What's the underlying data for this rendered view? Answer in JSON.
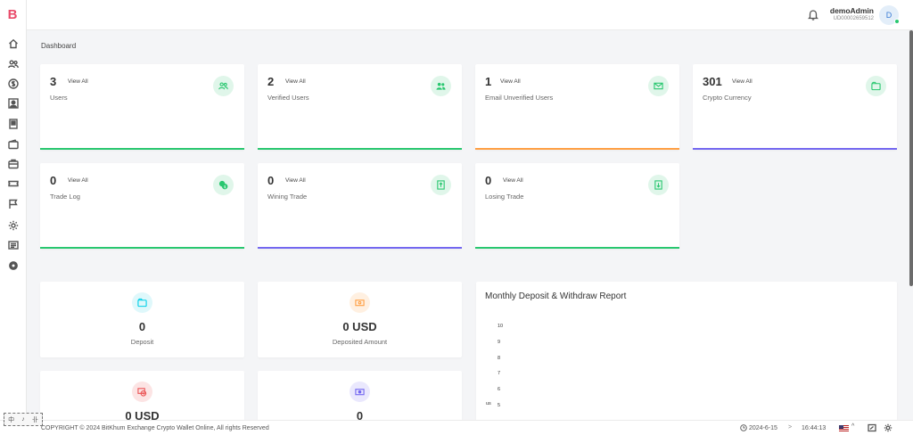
{
  "logo": {
    "letter": "B",
    "color": "#e94b6a"
  },
  "sidebar": {
    "items": [
      {
        "icon": "home-icon"
      },
      {
        "icon": "users-icon"
      },
      {
        "icon": "dollar-icon"
      },
      {
        "icon": "user-card-icon"
      },
      {
        "icon": "document-icon"
      },
      {
        "icon": "wallet-icon"
      },
      {
        "icon": "briefcase-icon"
      },
      {
        "icon": "ticket-icon"
      },
      {
        "icon": "flag-icon"
      },
      {
        "icon": "gear-icon"
      },
      {
        "icon": "list-icon"
      },
      {
        "icon": "settings-icon"
      }
    ]
  },
  "header": {
    "user_name": "demoAdmin",
    "user_id": "UD00002659512",
    "avatar_letter": "D"
  },
  "page_title": "Dashboard",
  "stats": [
    {
      "value": "3",
      "view_label": "View All",
      "label": "Users",
      "icon": "users-icon",
      "accent": "#28c76f"
    },
    {
      "value": "2",
      "view_label": "View All",
      "label": "Verified Users",
      "icon": "verified-users-icon",
      "accent": "#28c76f"
    },
    {
      "value": "1",
      "view_label": "View All",
      "label": "Email Unverified Users",
      "icon": "email-icon",
      "accent": "#ff9f43"
    },
    {
      "value": "301",
      "view_label": "View All",
      "label": "Crypto Currency",
      "icon": "wallet-icon",
      "accent": "#7367f0"
    },
    {
      "value": "0",
      "view_label": "View All",
      "label": "Trade Log",
      "icon": "coins-icon",
      "accent": "#28c76f"
    },
    {
      "value": "0",
      "view_label": "View All",
      "label": "Wining Trade",
      "icon": "upload-icon",
      "accent": "#7367f0"
    },
    {
      "value": "0",
      "view_label": "View All",
      "label": "Losing Trade",
      "icon": "download-icon",
      "accent": "#28c76f"
    }
  ],
  "mini_cards": [
    {
      "value": "0",
      "label": "Deposit",
      "icon": "wallet-icon",
      "color": "#00cfe8"
    },
    {
      "value": "0 USD",
      "label": "Deposited Amount",
      "icon": "cash-icon",
      "color": "#ff9f43"
    },
    {
      "value": "0 USD",
      "label": "",
      "icon": "cash-cancel-icon",
      "color": "#ea5455"
    },
    {
      "value": "0",
      "label": "",
      "icon": "cash-purple-icon",
      "color": "#7367f0"
    }
  ],
  "chart": {
    "title": "Monthly Deposit & Withdraw Report",
    "y_ticks": [
      "10",
      "9",
      "8",
      "7",
      "6",
      "5"
    ],
    "y_label": "us"
  },
  "chart_data": {
    "type": "bar",
    "title": "Monthly Deposit & Withdraw Report",
    "categories": [],
    "series": [],
    "ylim": [
      0,
      10
    ],
    "xlabel": "",
    "ylabel": ""
  },
  "footer": {
    "copyright": "COPYRIGHT © 2024 BitKhum Exchange Crypto Wallet Online, All rights Reserved",
    "date": "2024-6-15",
    "separator": ">",
    "time": "16:44:13",
    "caret": "^"
  },
  "tools": {
    "a": "中",
    "b": "♪",
    "c": "卝"
  }
}
